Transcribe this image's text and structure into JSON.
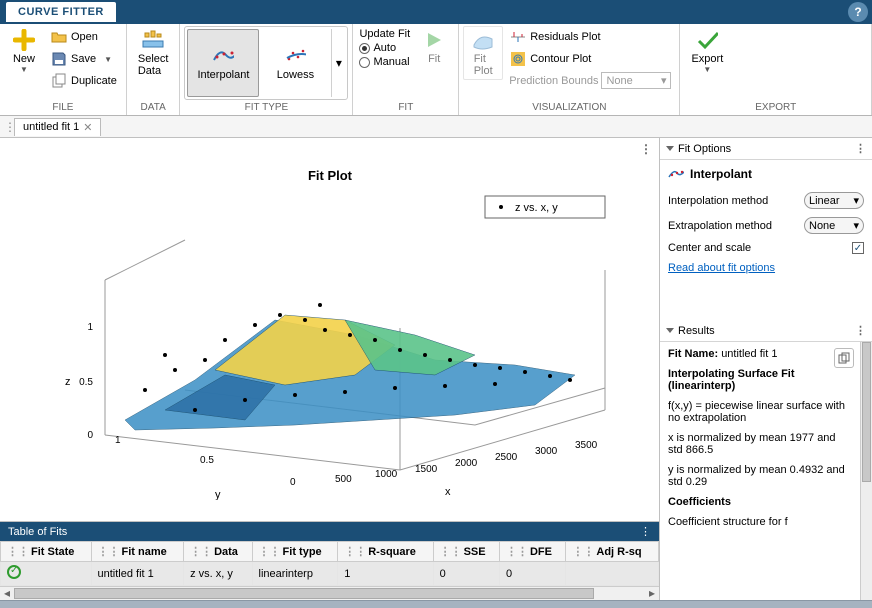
{
  "app_tab": "CURVE FITTER",
  "toolstrip": {
    "file": {
      "new": "New",
      "open": "Open",
      "save": "Save",
      "duplicate": "Duplicate",
      "label": "FILE"
    },
    "data": {
      "select_data": "Select\nData",
      "label": "DATA"
    },
    "fittype": {
      "interpolant": "Interpolant",
      "lowess": "Lowess",
      "label": "FIT TYPE"
    },
    "fit": {
      "update": "Update Fit",
      "auto": "Auto",
      "manual": "Manual",
      "fitbtn": "Fit",
      "label": "FIT"
    },
    "viz": {
      "fitplot": "Fit\nPlot",
      "resid": "Residuals Plot",
      "contour": "Contour Plot",
      "predlabel": "Prediction Bounds",
      "predval": "None",
      "label": "VISUALIZATION"
    },
    "export": {
      "btn": "Export",
      "label": "EXPORT"
    }
  },
  "doctab": "untitled fit 1",
  "plot": {
    "title": "Fit Plot",
    "legend": "z vs. x, y",
    "xlabel": "x",
    "ylabel": "y",
    "zlabel": "z",
    "xticks": [
      500,
      1000,
      1500,
      2000,
      2500,
      3000,
      3500
    ],
    "yticks": [
      0,
      0.5,
      1
    ],
    "zticks": [
      0,
      0.5,
      1
    ]
  },
  "tableOfFits": {
    "title": "Table of Fits",
    "headers": [
      "Fit State",
      "Fit name",
      "Data",
      "Fit type",
      "R-square",
      "SSE",
      "DFE",
      "Adj R-sq"
    ],
    "row": {
      "state": "ok",
      "name": "untitled fit 1",
      "data": "z vs. x, y",
      "type": "linearinterp",
      "rsq": "1",
      "sse": "0",
      "dfe": "0",
      "adjrsq": ""
    }
  },
  "fitOptions": {
    "title": "Fit Options",
    "method_title": "Interpolant",
    "interp_label": "Interpolation method",
    "interp_val": "Linear",
    "extrap_label": "Extrapolation method",
    "extrap_val": "None",
    "centerscale_label": "Center and scale",
    "centerscale_val": true,
    "readlink": "Read about fit options"
  },
  "results": {
    "title": "Results",
    "fitname_label": "Fit Name:",
    "fitname_val": "untitled fit 1",
    "heading": "Interpolating Surface Fit (linearinterp)",
    "eq": "f(x,y) = piecewise linear surface with no extrapolation",
    "xnorm": "x is normalized by mean 1977 and std 866.5",
    "ynorm": "y is normalized by mean 0.4932 and std 0.29",
    "coeff_hdr": "Coefficients",
    "coeff_txt": "Coefficient structure for f"
  },
  "chart_data": {
    "type": "surface",
    "title": "Fit Plot",
    "legend": [
      "z vs. x, y"
    ],
    "xlabel": "x",
    "ylabel": "y",
    "zlabel": "z",
    "xrange": [
      500,
      3500
    ],
    "yrange": [
      0,
      1
    ],
    "zrange": [
      0,
      1
    ],
    "xticks": [
      500,
      1000,
      1500,
      2000,
      2500,
      3000,
      3500
    ],
    "yticks": [
      0,
      0.5,
      1
    ],
    "zticks": [
      0,
      0.5,
      1
    ],
    "note": "Scatter points lie approximately on an interpolated surface; z values vary between ~0 and ~1 across the x-y grid with a raised ridge near center."
  }
}
